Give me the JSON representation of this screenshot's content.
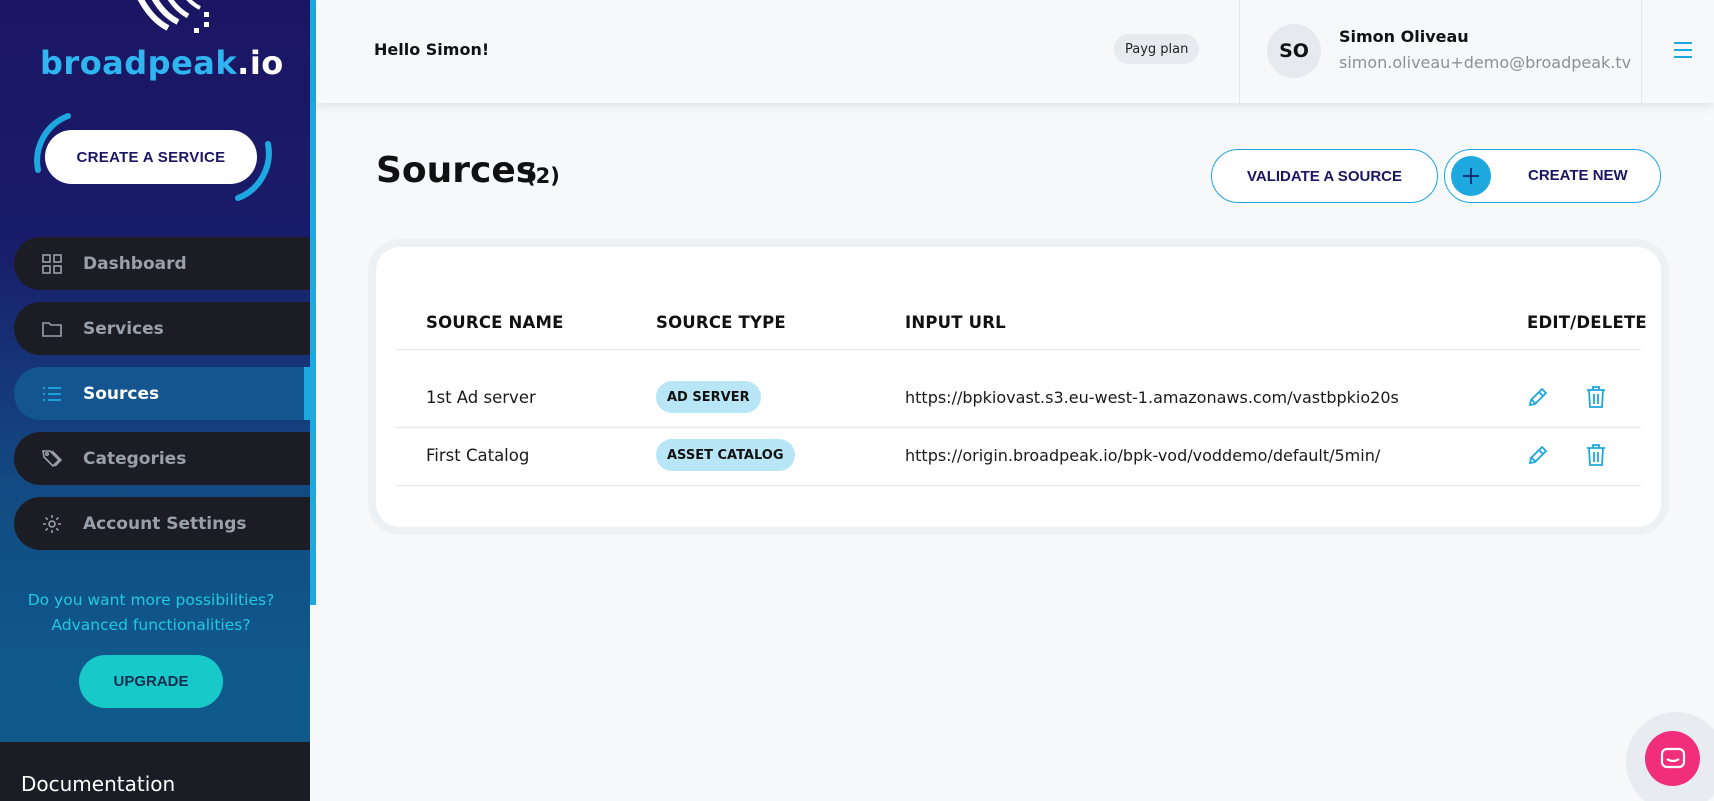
{
  "sidebar": {
    "brand": {
      "name": "broadpeak",
      "suffix": ".io"
    },
    "create_service_label": "CREATE A SERVICE",
    "items": [
      {
        "label": "Dashboard",
        "icon": "grid-icon",
        "active": false
      },
      {
        "label": "Services",
        "icon": "folder-icon",
        "active": false
      },
      {
        "label": "Sources",
        "icon": "list-icon",
        "active": true
      },
      {
        "label": "Categories",
        "icon": "tags-icon",
        "active": false
      },
      {
        "label": "Account Settings",
        "icon": "gear-icon",
        "active": false
      }
    ],
    "promo_line1": "Do you want more possibilities?",
    "promo_line2": "Advanced functionalities?",
    "upgrade_label": "UPGRADE",
    "docs_label": "Documentation"
  },
  "header": {
    "greeting": "Hello Simon!",
    "plan": "Payg plan",
    "avatar_initials": "SO",
    "user_name": "Simon Oliveau",
    "user_email": "simon.oliveau+demo@broadpeak.tv"
  },
  "main": {
    "title": "Sources",
    "count": "(2)",
    "validate_label": "VALIDATE A SOURCE",
    "create_new_label": "CREATE NEW",
    "columns": [
      "SOURCE NAME",
      "SOURCE TYPE",
      "INPUT URL",
      "EDIT/DELETE"
    ],
    "rows": [
      {
        "name": "1st Ad server",
        "type": "AD SERVER",
        "url": "https://bpkiovast.s3.eu-west-1.amazonaws.com/vastbpkio20s"
      },
      {
        "name": "First Catalog",
        "type": "ASSET CATALOG",
        "url": "https://origin.broadpeak.io/bpk-vod/voddemo/default/5min/"
      }
    ]
  },
  "colors": {
    "accent": "#1ea8e0",
    "navy": "#1b1663",
    "upgrade": "#17c9c9",
    "badge": "#b9e6f6",
    "chat": "#f02e7c"
  }
}
